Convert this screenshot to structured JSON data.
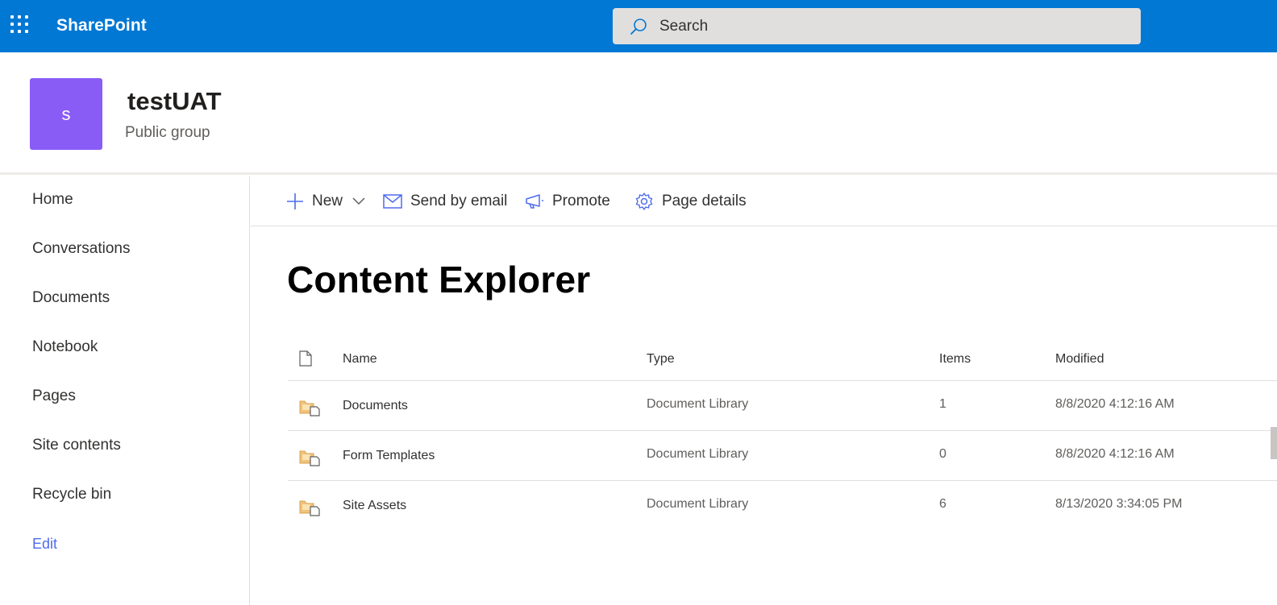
{
  "suitebar": {
    "brand": "SharePoint",
    "search_placeholder": "Search",
    "color": "#0078d4"
  },
  "site": {
    "logo_letter": "s",
    "title": "testUAT",
    "subtitle": "Public group",
    "logo_color": "#8a5cf6"
  },
  "nav": {
    "items": [
      {
        "label": "Home"
      },
      {
        "label": "Conversations"
      },
      {
        "label": "Documents"
      },
      {
        "label": "Notebook"
      },
      {
        "label": "Pages"
      },
      {
        "label": "Site contents"
      },
      {
        "label": "Recycle bin"
      }
    ],
    "edit": "Edit"
  },
  "commands": {
    "new": "New",
    "send_email": "Send by email",
    "promote": "Promote",
    "page_details": "Page details",
    "icon_color": "#4f6bed"
  },
  "page": {
    "title": "Content Explorer"
  },
  "table": {
    "headers": {
      "name": "Name",
      "type": "Type",
      "items": "Items",
      "modified": "Modified"
    },
    "rows": [
      {
        "name": "Documents",
        "type": "Document Library",
        "items": "1",
        "modified": "8/8/2020 4:12:16 AM",
        "icon": "library-folder-icon"
      },
      {
        "name": "Form Templates",
        "type": "Document Library",
        "items": "0",
        "modified": "8/8/2020 4:12:16 AM",
        "icon": "library-folder-icon"
      },
      {
        "name": "Site Assets",
        "type": "Document Library",
        "items": "6",
        "modified": "8/13/2020 3:34:05 PM",
        "icon": "library-folder-icon"
      }
    ]
  }
}
